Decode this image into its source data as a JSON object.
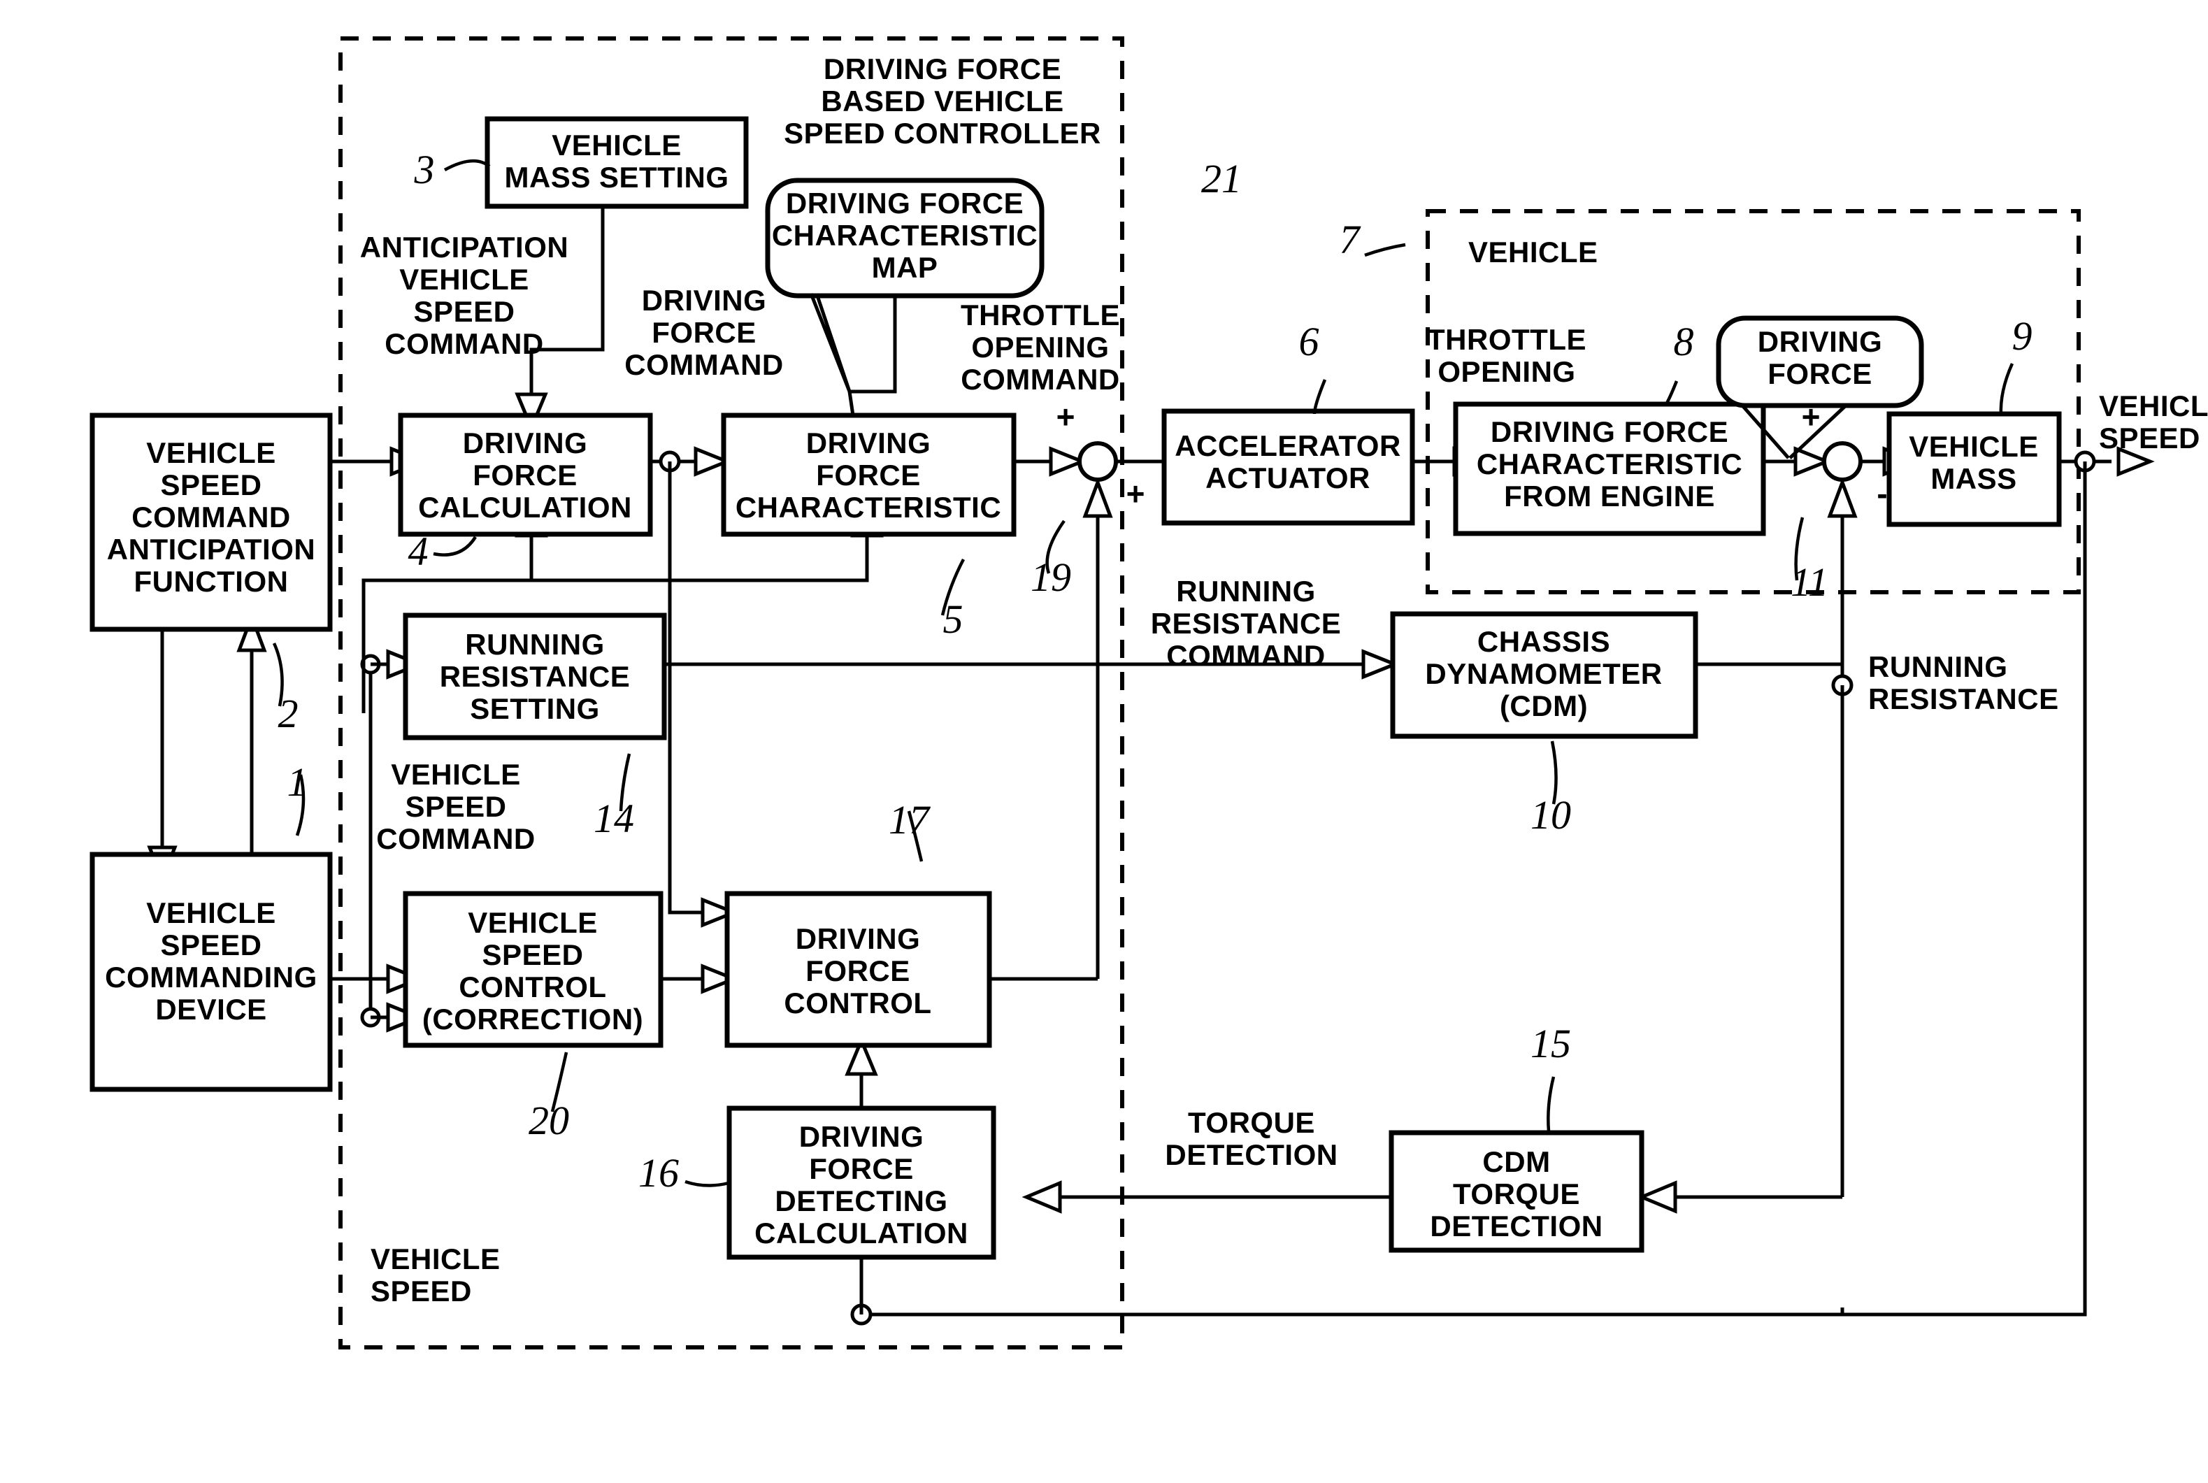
{
  "diagram": {
    "title_note": "Driving force based vehicle speed control block diagram",
    "groups": [
      {
        "id": "controller",
        "label_lines": [
          "DRIVING FORCE",
          "BASED VEHICLE",
          "SPEED CONTROLLER"
        ],
        "ref": "21"
      },
      {
        "id": "vehicle",
        "label_lines": [
          "VEHICLE"
        ],
        "ref": "7"
      }
    ],
    "blocks": [
      {
        "id": "vs-cmd-anticipation",
        "lines": [
          "VEHICLE",
          "SPEED",
          "COMMAND",
          "ANTICIPATION",
          "FUNCTION"
        ],
        "ref": "2"
      },
      {
        "id": "vs-commanding-device",
        "lines": [
          "VEHICLE",
          "SPEED",
          "COMMANDING",
          "DEVICE"
        ],
        "ref": "1"
      },
      {
        "id": "vehicle-mass-setting",
        "lines": [
          "VEHICLE",
          "MASS SETTING"
        ],
        "ref": "3"
      },
      {
        "id": "driving-force-calculation",
        "lines": [
          "DRIVING",
          "FORCE",
          "CALCULATION"
        ],
        "ref": "4"
      },
      {
        "id": "driving-force-characteristic",
        "lines": [
          "DRIVING",
          "FORCE",
          "CHARACTERISTIC"
        ],
        "ref": "5"
      },
      {
        "id": "running-resistance-setting",
        "lines": [
          "RUNNING",
          "RESISTANCE",
          "SETTING"
        ],
        "ref": "14"
      },
      {
        "id": "vehicle-speed-control-correction",
        "lines": [
          "VEHICLE",
          "SPEED",
          "CONTROL",
          "(CORRECTION)"
        ],
        "ref": "20"
      },
      {
        "id": "driving-force-control",
        "lines": [
          "DRIVING",
          "FORCE",
          "CONTROL"
        ],
        "ref": "17"
      },
      {
        "id": "driving-force-detecting-calculation",
        "lines": [
          "DRIVING",
          "FORCE",
          "DETECTING",
          "CALCULATION"
        ],
        "ref": "16"
      },
      {
        "id": "accelerator-actuator",
        "lines": [
          "ACCELERATOR",
          "ACTUATOR"
        ],
        "ref": "6"
      },
      {
        "id": "driving-force-characteristic-from-engine",
        "lines": [
          "DRIVING FORCE",
          "CHARACTERISTIC",
          "FROM ENGINE"
        ],
        "ref": "8"
      },
      {
        "id": "vehicle-mass",
        "lines": [
          "VEHICLE",
          "MASS"
        ],
        "ref": "9"
      },
      {
        "id": "chassis-dynamometer",
        "lines": [
          "CHASSIS",
          "DYNAMOMETER",
          "(CDM)"
        ],
        "ref": "10"
      },
      {
        "id": "cdm-torque-detection",
        "lines": [
          "CDM",
          "TORQUE",
          "DETECTION"
        ],
        "ref": "15"
      }
    ],
    "callouts": [
      {
        "id": "driving-force-characteristic-map",
        "lines": [
          "DRIVING FORCE",
          "CHARACTERISTIC",
          "MAP"
        ]
      },
      {
        "id": "driving-force-callout",
        "lines": [
          "DRIVING",
          "FORCE"
        ]
      }
    ],
    "signal_labels": [
      {
        "id": "anticipation-vehicle-speed-command",
        "lines": [
          "ANTICIPATION",
          "VEHICLE",
          "SPEED",
          "COMMAND"
        ]
      },
      {
        "id": "driving-force-command",
        "lines": [
          "DRIVING",
          "FORCE",
          "COMMAND"
        ]
      },
      {
        "id": "throttle-opening-command",
        "lines": [
          "THROTTLE",
          "OPENING",
          "COMMAND"
        ]
      },
      {
        "id": "throttle-opening",
        "lines": [
          "THROTTLE",
          "OPENING"
        ]
      },
      {
        "id": "vehicle-speed-command",
        "lines": [
          "VEHICLE",
          "SPEED",
          "COMMAND"
        ]
      },
      {
        "id": "running-resistance-command",
        "lines": [
          "RUNNING",
          "RESISTANCE",
          "COMMAND"
        ]
      },
      {
        "id": "running-resistance",
        "lines": [
          "RUNNING",
          "RESISTANCE"
        ]
      },
      {
        "id": "torque-detection",
        "lines": [
          "TORQUE",
          "DETECTION"
        ]
      },
      {
        "id": "vehicle-speed-out",
        "lines": [
          "VEHICLE",
          "SPEED"
        ]
      },
      {
        "id": "vehicle-speed-feedback",
        "lines": [
          "VEHICLE",
          "SPEED"
        ]
      }
    ],
    "ref_numbers": [
      "1",
      "2",
      "3",
      "4",
      "5",
      "6",
      "7",
      "8",
      "9",
      "10",
      "11",
      "14",
      "15",
      "16",
      "17",
      "19",
      "20",
      "21"
    ],
    "sum_signs": {
      "junction19": [
        "+",
        "+"
      ],
      "junction11": [
        "+",
        "-"
      ]
    },
    "junction_refs": {
      "junction19": "19",
      "junction11": "11"
    }
  }
}
